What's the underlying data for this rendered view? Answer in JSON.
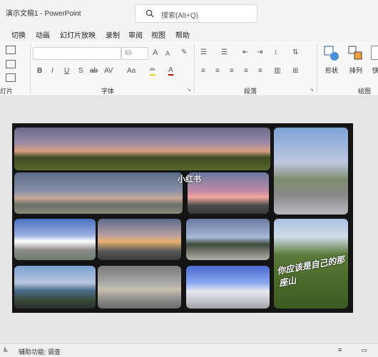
{
  "window": {
    "title": "演示文稿1  -  PowerPoint"
  },
  "search": {
    "placeholder": "搜索(Alt+Q)"
  },
  "menu": [
    "切换",
    "动画",
    "幻灯片放映",
    "录制",
    "审阅",
    "视图",
    "帮助"
  ],
  "ribbon": {
    "group_left_label": "灯片",
    "font_group_label": "字体",
    "font_name": "",
    "font_size": "65",
    "paragraph_group_label": "段落",
    "shapes_label": "形状",
    "arrange_label": "排列",
    "quickstyles_label": "快",
    "drawing_group_label": "绘图",
    "font_buttons": [
      "B",
      "I",
      "U",
      "S",
      "ab",
      "AV",
      "Aa"
    ],
    "size_buttons": [
      "A",
      "A"
    ]
  },
  "slide": {
    "watermark": "小红书",
    "calligraphy": "你应该是自己的那座山"
  },
  "status": {
    "accessibility": "辅助功能: 调查"
  },
  "colors": {
    "accent": "#2b579a",
    "slide_bg": "#141414"
  }
}
